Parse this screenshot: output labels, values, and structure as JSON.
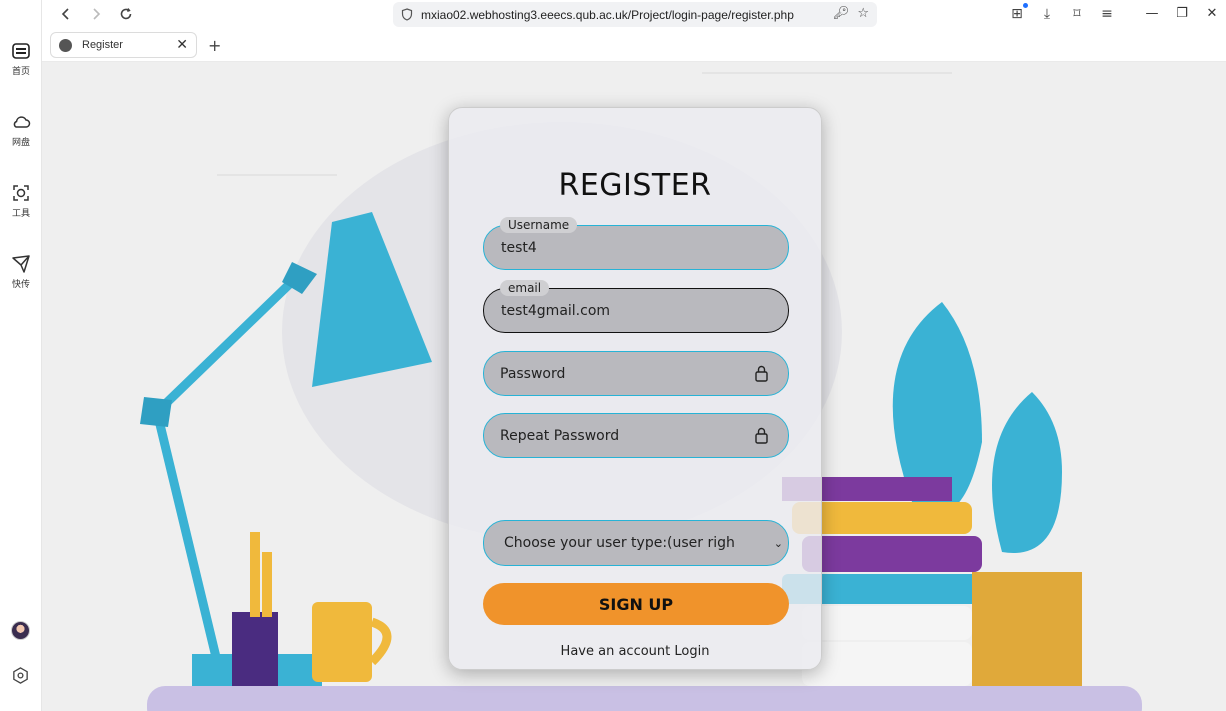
{
  "sidebar": {
    "items": [
      {
        "label": "首页",
        "icon": "home-icon"
      },
      {
        "label": "网盘",
        "icon": "cloud-icon"
      },
      {
        "label": "工具",
        "icon": "tools-icon"
      },
      {
        "label": "快传",
        "icon": "send-icon"
      }
    ]
  },
  "browser": {
    "url": "mxiao02.webhosting3.eeecs.qub.ac.uk/Project/login-page/register.php",
    "tab_title": "Register"
  },
  "form": {
    "title": "REGISTER",
    "username_label": "Username",
    "username_value": "test4",
    "email_label": "email",
    "email_value": "test4gmail.com",
    "password_placeholder": "Password",
    "repeat_password_placeholder": "Repeat Password",
    "user_type_selected": "Choose your user type:(user right of",
    "signup_label": "SIGN UP",
    "login_text": "Have an account Login"
  },
  "colors": {
    "accent": "#27b3d6",
    "button": "#f0932b",
    "desk": "#c9c0e4"
  }
}
